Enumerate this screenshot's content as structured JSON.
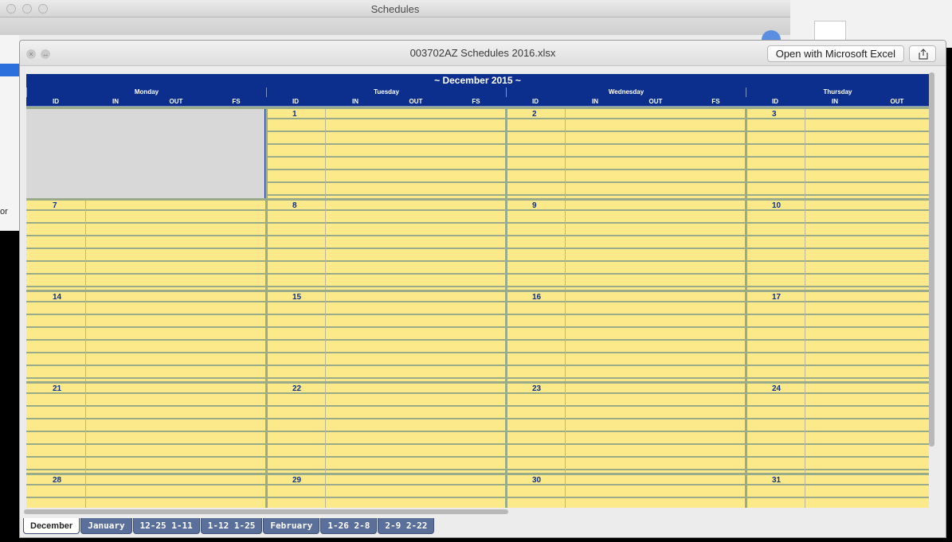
{
  "background_window": {
    "title": "Schedules",
    "cut_text": "or"
  },
  "quicklook": {
    "filename": "003702AZ Schedules 2016.xlsx",
    "open_button": "Open with Microsoft Excel",
    "share_icon": "share-icon"
  },
  "sheet": {
    "month_title": "~ December 2015 ~",
    "days": [
      "Monday",
      "Tuesday",
      "Wednesday",
      "Thursday"
    ],
    "columns": [
      "ID",
      "IN",
      "OUT",
      "FS"
    ],
    "weeks": [
      [
        "",
        "1",
        "2",
        "3"
      ],
      [
        "7",
        "8",
        "9",
        "10"
      ],
      [
        "14",
        "15",
        "16",
        "17"
      ],
      [
        "21",
        "22",
        "23",
        "24"
      ],
      [
        "28",
        "29",
        "30",
        "31"
      ]
    ]
  },
  "tabs": [
    "December",
    "January",
    "12-25 1-11",
    "1-12 1-25",
    "February",
    "1-26 2-8",
    "2-9 2-22"
  ],
  "active_tab": "December"
}
